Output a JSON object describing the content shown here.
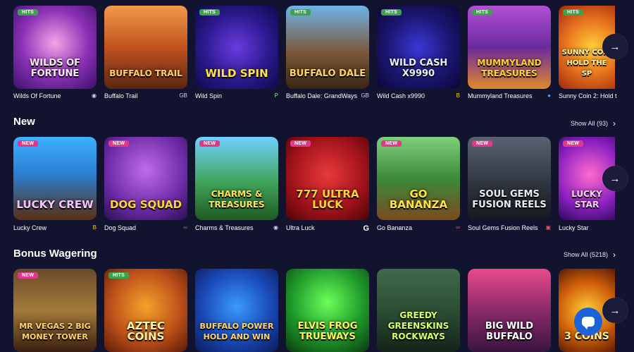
{
  "sections": [
    {
      "title": "",
      "show_all": "",
      "games": [
        {
          "name": "Wilds Of Fortune",
          "art": "WILDS OF FORTUNE",
          "badge": "HITS",
          "provider_icon": "provider-icon"
        },
        {
          "name": "Buffalo Trail",
          "art": "BUFFALO TRAIL",
          "badge": "",
          "provider_icon": "provider-icon"
        },
        {
          "name": "Wild Spin",
          "art": "WILD SPIN",
          "badge": "HITS",
          "provider_icon": "provider-icon"
        },
        {
          "name": "Buffalo Dale: GrandWays",
          "art": "BUFFALO DALE",
          "badge": "HITS",
          "provider_icon": "provider-icon"
        },
        {
          "name": "Wild Cash x9990",
          "art": "WILD CASH X9990",
          "badge": "HITS",
          "provider_icon": "provider-icon"
        },
        {
          "name": "Mummyland Treasures",
          "art": "MUMMYLAND TREASURES",
          "badge": "HITS",
          "provider_icon": "provider-icon"
        },
        {
          "name": "Sunny Coin 2: Hold t",
          "art": "SUNNY COIN HOLD THE SP",
          "badge": "HITS",
          "provider_icon": ""
        }
      ]
    },
    {
      "title": "New",
      "show_all": "Show All (93)",
      "games": [
        {
          "name": "Lucky Crew",
          "art": "LUCKY CREW",
          "badge": "NEW",
          "provider_icon": "provider-icon"
        },
        {
          "name": "Dog Squad",
          "art": "DOG SQUAD",
          "badge": "NEW",
          "provider_icon": "provider-icon"
        },
        {
          "name": "Charms & Treasures",
          "art": "CHARMS & TREASURES",
          "badge": "NEW",
          "provider_icon": "provider-icon"
        },
        {
          "name": "Ultra Luck",
          "art": "777 ULTRA LUCK",
          "badge": "NEW",
          "provider_icon": "provider-icon"
        },
        {
          "name": "Go Bananza",
          "art": "GO BANANZA",
          "badge": "NEW",
          "provider_icon": "provider-icon"
        },
        {
          "name": "Soul Gems Fusion Reels",
          "art": "SOUL GEMS FUSION REELS",
          "badge": "NEW",
          "provider_icon": "provider-icon"
        },
        {
          "name": "Lucky Star",
          "art": "LUCKY STAR",
          "badge": "NEW",
          "provider_icon": ""
        }
      ]
    },
    {
      "title": "Bonus Wagering",
      "show_all": "Show All (5218)",
      "games": [
        {
          "name": "",
          "art": "MR VEGAS 2 BIG MONEY TOWER",
          "badge": "NEW",
          "provider_icon": ""
        },
        {
          "name": "",
          "art": "AZTEC COINS",
          "badge": "HITS",
          "provider_icon": ""
        },
        {
          "name": "",
          "art": "BUFFALO POWER HOLD AND WIN",
          "badge": "",
          "provider_icon": ""
        },
        {
          "name": "",
          "art": "ELVIS FROG TRUEWAYS",
          "badge": "",
          "provider_icon": ""
        },
        {
          "name": "",
          "art": "GREEDY GREENSKINS ROCKWAYS",
          "badge": "",
          "provider_icon": ""
        },
        {
          "name": "",
          "art": "BIG WILD BUFFALO",
          "badge": "",
          "provider_icon": ""
        },
        {
          "name": "",
          "art": "3 COINS",
          "badge": "",
          "provider_icon": ""
        }
      ]
    }
  ],
  "colors": {
    "background": "#12132e",
    "hits_badge": "#3aa34b",
    "new_badge": "#e0398a",
    "chat_button": "#1e62d8"
  },
  "icons": {
    "scroll_arrow": "→",
    "show_all_chevron": "›"
  }
}
